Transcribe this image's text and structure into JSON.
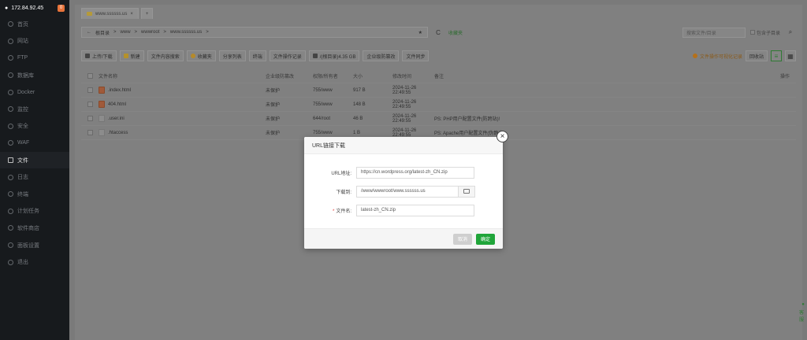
{
  "sidebar": {
    "ip": "172.84.92.45",
    "badge": "0",
    "items": [
      {
        "label": "首页"
      },
      {
        "label": "网站"
      },
      {
        "label": "FTP"
      },
      {
        "label": "数据库"
      },
      {
        "label": "Docker"
      },
      {
        "label": "监控"
      },
      {
        "label": "安全"
      },
      {
        "label": "WAF"
      },
      {
        "label": "文件"
      },
      {
        "label": "日志"
      },
      {
        "label": "终端"
      },
      {
        "label": "计划任务"
      },
      {
        "label": "软件商店"
      },
      {
        "label": "面板设置"
      },
      {
        "label": "退出"
      }
    ]
  },
  "tabs": {
    "current": "www.ssssss.us",
    "close": "×",
    "add": "+"
  },
  "address": {
    "back": "←",
    "crumbs": [
      "根目录",
      "www",
      "wwwroot",
      "www.ssssss.us"
    ],
    "sep": ">",
    "star": "★",
    "refresh": "C",
    "favorites": "收藏夹",
    "search_placeholder": "搜索文件/目录",
    "include_sub": "包含子目录"
  },
  "toolbar": {
    "upload": "上传/下载",
    "new": "新建",
    "search_content": "文件内容搜索",
    "favorites": "收藏夹",
    "share_list": "分享列表",
    "terminal": "终端",
    "op_log": "文件操作记录",
    "disk": "/(根目录)4.35 GB",
    "enterprise": "企业级防篡改",
    "sync": "文件同步",
    "warn": "文件操作可视化记录",
    "recycle": "回收站"
  },
  "table": {
    "headers": [
      "文件名称",
      "企业级防篡改",
      "权限/所有者",
      "大小",
      "修改时间",
      "备注",
      "操作"
    ],
    "rows": [
      {
        "name": ".index.html",
        "protect": "未保护",
        "perm": "755/www",
        "size": "917 B",
        "time": "2024-11-26 22:49:55",
        "note": ""
      },
      {
        "name": "404.html",
        "protect": "未保护",
        "perm": "755/www",
        "size": "148 B",
        "time": "2024-11-26 22:49:55",
        "note": ""
      },
      {
        "name": ".user.ini",
        "protect": "未保护",
        "perm": "644/root",
        "size": "46 B",
        "time": "2024-11-26 22:49:55",
        "note": "PS: PHP用户配置文件(防跨站)!"
      },
      {
        "name": ".htaccess",
        "protect": "未保护",
        "perm": "755/www",
        "size": "1 B",
        "time": "2024-11-26 22:49:55",
        "note": "PS: Apache用户配置文件(伪静态)"
      }
    ]
  },
  "dialog": {
    "title": "URL链接下载",
    "url_label": "URL地址:",
    "url_value": "https://cn.wordpress.org/latest-zh_CN.zip",
    "dest_label": "下载到:",
    "dest_value": "/www/wwwroot/www.ssssss.us",
    "name_label": "文件名:",
    "name_value": "latest-zh_CN.zip",
    "required_mark": "*",
    "cancel": "取消",
    "ok": "确定"
  },
  "float": {
    "label": "客服"
  },
  "colors": {
    "accent": "#20a53a",
    "sidebar": "#171a1d",
    "warn_badge": "#e8733a"
  }
}
